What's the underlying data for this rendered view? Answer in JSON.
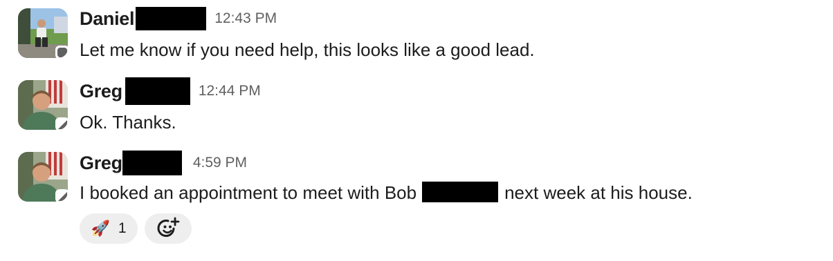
{
  "messages": [
    {
      "author": "Daniel",
      "time": "12:43 PM",
      "text": "Let me know if you need help, this looks like a good lead.",
      "avatar": "daniel-avatar",
      "presence": "away"
    },
    {
      "author": "Greg",
      "time": "12:44 PM",
      "text": "Ok. Thanks.",
      "avatar": "greg-avatar",
      "presence": "away"
    },
    {
      "author": "Greg",
      "time": "4:59 PM",
      "text_before": "I booked an appointment to meet with Bob",
      "text_after": "next week at his house.",
      "avatar": "greg-avatar",
      "presence": "away",
      "reactions": [
        {
          "emoji": "🚀",
          "icon": "rocket-icon",
          "count": "1"
        }
      ],
      "add_reaction_icon": "add-reaction-icon"
    }
  ],
  "colors": {
    "text": "#1d1c1d",
    "timestamp": "#616061",
    "reaction_bg": "#eeeeee",
    "presence_away": "#616061"
  }
}
